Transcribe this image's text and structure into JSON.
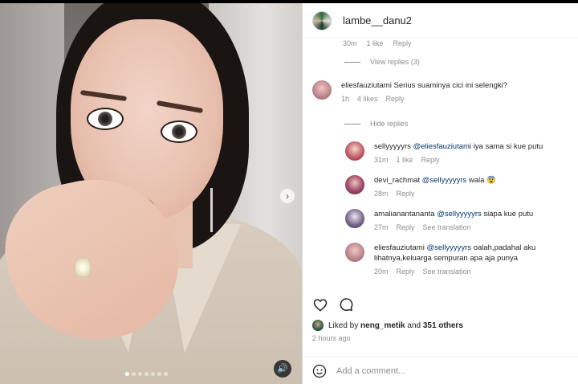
{
  "post": {
    "username": "lambe__danu2",
    "carousel": {
      "dot_count": 7,
      "active_index": 0
    }
  },
  "comments": {
    "cut_off": {
      "time": "30m",
      "likes": "1 like",
      "reply": "Reply"
    },
    "view_replies": "View replies (3)",
    "main": {
      "user": "eliesfauziutami",
      "text": "Serius suaminya cici ini selengki?",
      "time": "1h",
      "likes": "4 likes",
      "reply": "Reply"
    },
    "hide_replies": "Hide replies",
    "replies": [
      {
        "user": "sellyyyyyrs",
        "mention": "@eliesfauziutami",
        "text": "iya sama si kue putu",
        "time": "31m",
        "likes": "1 like",
        "reply": "Reply",
        "extra": ""
      },
      {
        "user": "devi_rachmat",
        "mention": "@sellyyyyyrs",
        "text": "wala 😨",
        "time": "28m",
        "likes": "",
        "reply": "Reply",
        "extra": ""
      },
      {
        "user": "amalianantananta",
        "mention": "@sellyyyyyrs",
        "text": "siapa kue putu",
        "time": "27m",
        "likes": "",
        "reply": "Reply",
        "extra": "See translation"
      },
      {
        "user": "eliesfauziutami",
        "mention": "@sellyyyyyrs",
        "text": "oalah,padahal aku lihatnya,keluarga sempuran apa aja punya",
        "time": "20m",
        "likes": "",
        "reply": "Reply",
        "extra": "See translation"
      }
    ]
  },
  "likes": {
    "prefix": "Liked by",
    "user": "neng_metik",
    "joiner": "and",
    "others": "351 others"
  },
  "timeago": "2 hours ago",
  "add_comment": {
    "placeholder": "Add a comment..."
  }
}
